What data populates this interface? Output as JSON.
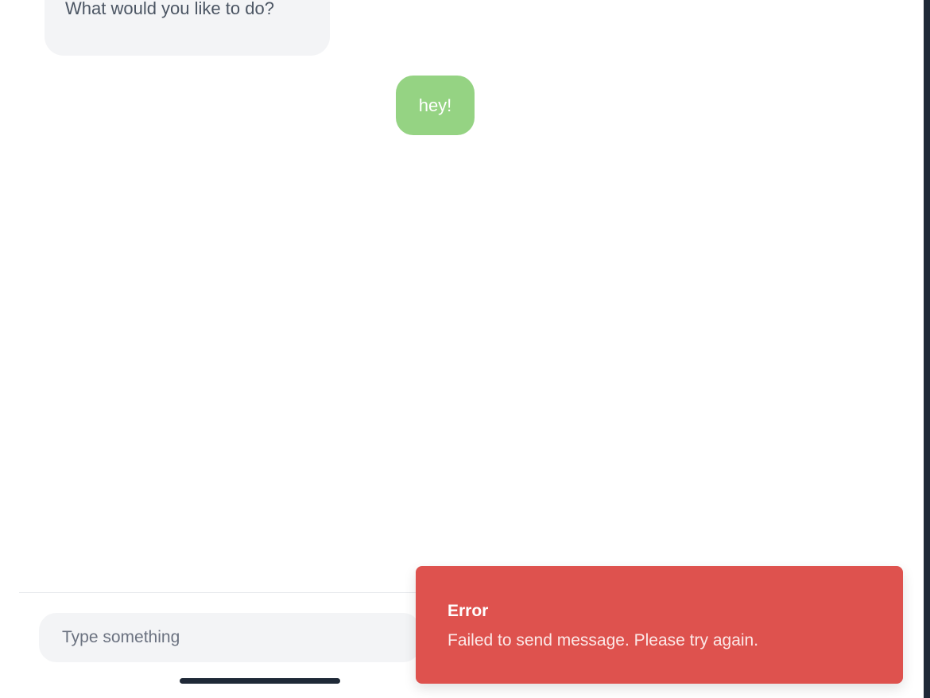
{
  "chat": {
    "messages": [
      {
        "sender": "bot",
        "text": "What would you like to do?"
      },
      {
        "sender": "user",
        "text": "hey!"
      }
    ]
  },
  "composer": {
    "input_placeholder": "Type something",
    "input_value": ""
  },
  "toast": {
    "title": "Error",
    "message": "Failed to send message. Please try again.",
    "color": "#de524e"
  },
  "colors": {
    "user_bubble": "#95d383",
    "bot_bubble": "#f3f4f6"
  }
}
